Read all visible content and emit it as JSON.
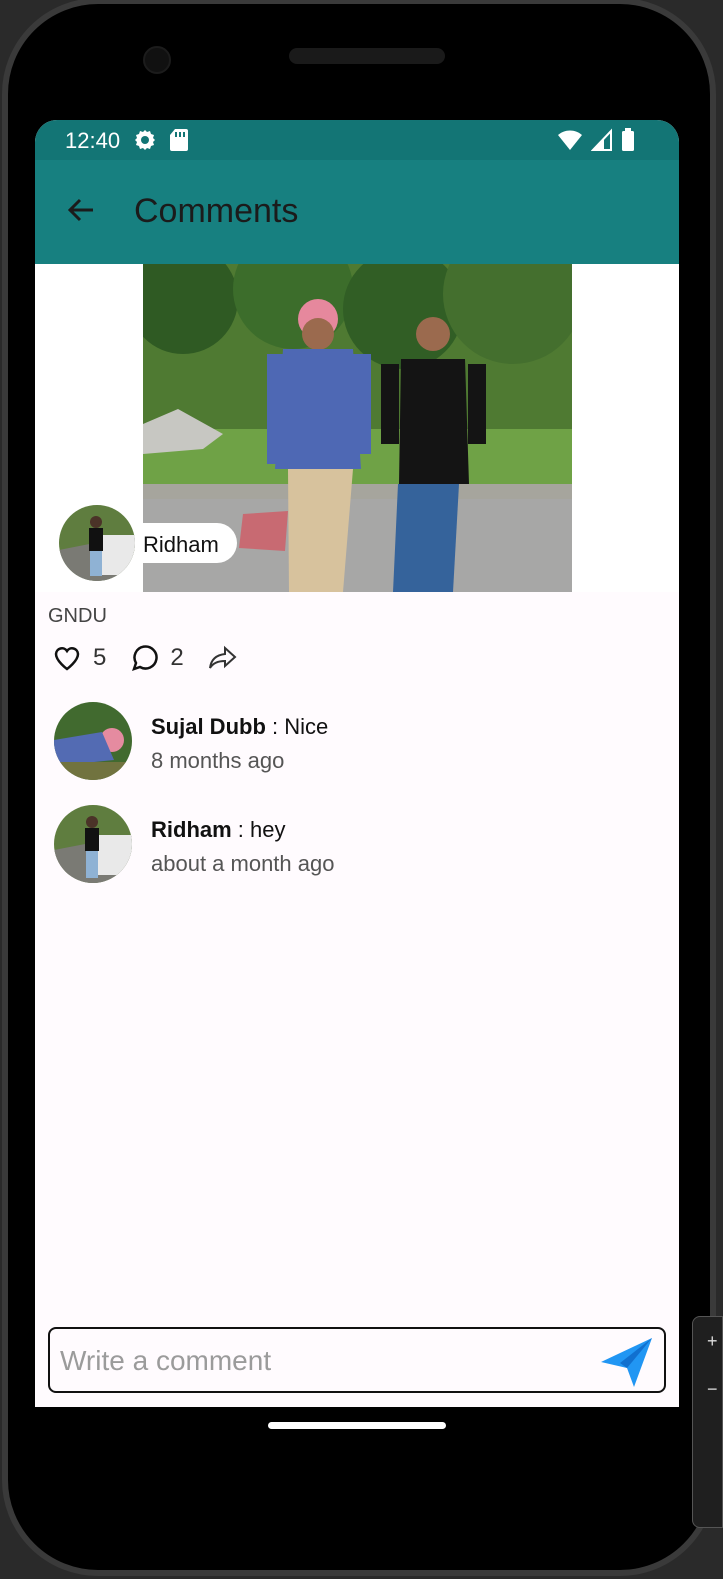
{
  "status_bar": {
    "time": "12:40",
    "icons_left": [
      "settings-icon",
      "sd-card-icon"
    ],
    "icons_right": [
      "wifi-icon",
      "cellular-signal-icon",
      "battery-icon"
    ]
  },
  "app_bar": {
    "title": "Comments",
    "back_icon": "arrow-left-icon",
    "color": "#178080"
  },
  "post": {
    "author_name": "Ridham",
    "caption": "GNDU",
    "likes": "5",
    "comments": "2",
    "share_icon": "share-icon"
  },
  "comments": [
    {
      "author": "Sujal Dubb",
      "separator": " : ",
      "text": "Nice",
      "time": "8 months ago"
    },
    {
      "author": "Ridham",
      "separator": " : ",
      "text": "hey",
      "time": "about a month ago"
    }
  ],
  "composer": {
    "placeholder": "Write a comment",
    "send_icon": "send-icon",
    "accent": "#2196f3"
  }
}
